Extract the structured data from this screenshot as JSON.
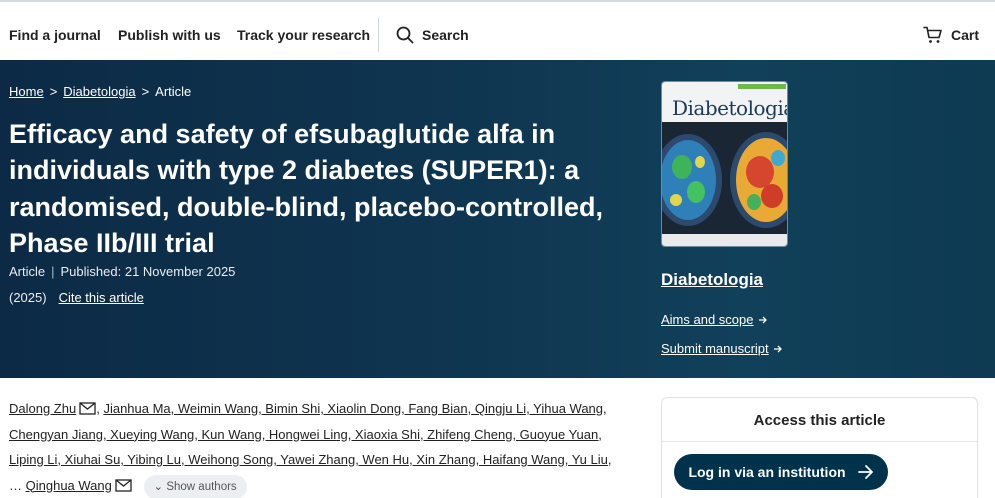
{
  "nav": {
    "find_journal": "Find a journal",
    "publish": "Publish with us",
    "track": "Track your research",
    "search": "Search",
    "cart": "Cart"
  },
  "breadcrumb": {
    "home": "Home",
    "journal": "Diabetologia",
    "current": "Article",
    "sep": ">"
  },
  "article": {
    "title": "Efficacy and safety of efsubaglutide alfa in individuals with type 2 diabetes (SUPER1): a randomised, double-blind, placebo-controlled, Phase IIb/III trial",
    "type": "Article",
    "published": "Published: 21 November 2025",
    "year": "(2025)",
    "cite": "Cite this article"
  },
  "journal_panel": {
    "cover_name": "Diabetologia",
    "name": "Diabetologia",
    "aims": "Aims and scope",
    "submit": "Submit manuscript"
  },
  "authors": {
    "first": "Dalong Zhu",
    "list": "Jianhua Ma, Weimin Wang, Bimin Shi, Xiaolin Dong, Fang Bian, Qingju Li, Yihua Wang, Chengyan Jiang, Xueying Wang, Kun Wang, Hongwei Ling, Xiaoxia Shi, Zhifeng Cheng, Guoyue Yuan, Liping Li, Xiuhai Su, Yibing Lu, Weihong Song, Yawei Zhang, Wen Hu, Xin Zhang, Haifang Wang, Yu Liu",
    "ellipsis": "…",
    "last": "Qinghua Wang",
    "show_authors": "Show authors"
  },
  "access": {
    "title": "Access this article",
    "login": "Log in via an institution"
  },
  "colors": {
    "hero_bg": "#0f3550",
    "button_bg": "#01324b",
    "cover_accent": "#6aba47"
  }
}
